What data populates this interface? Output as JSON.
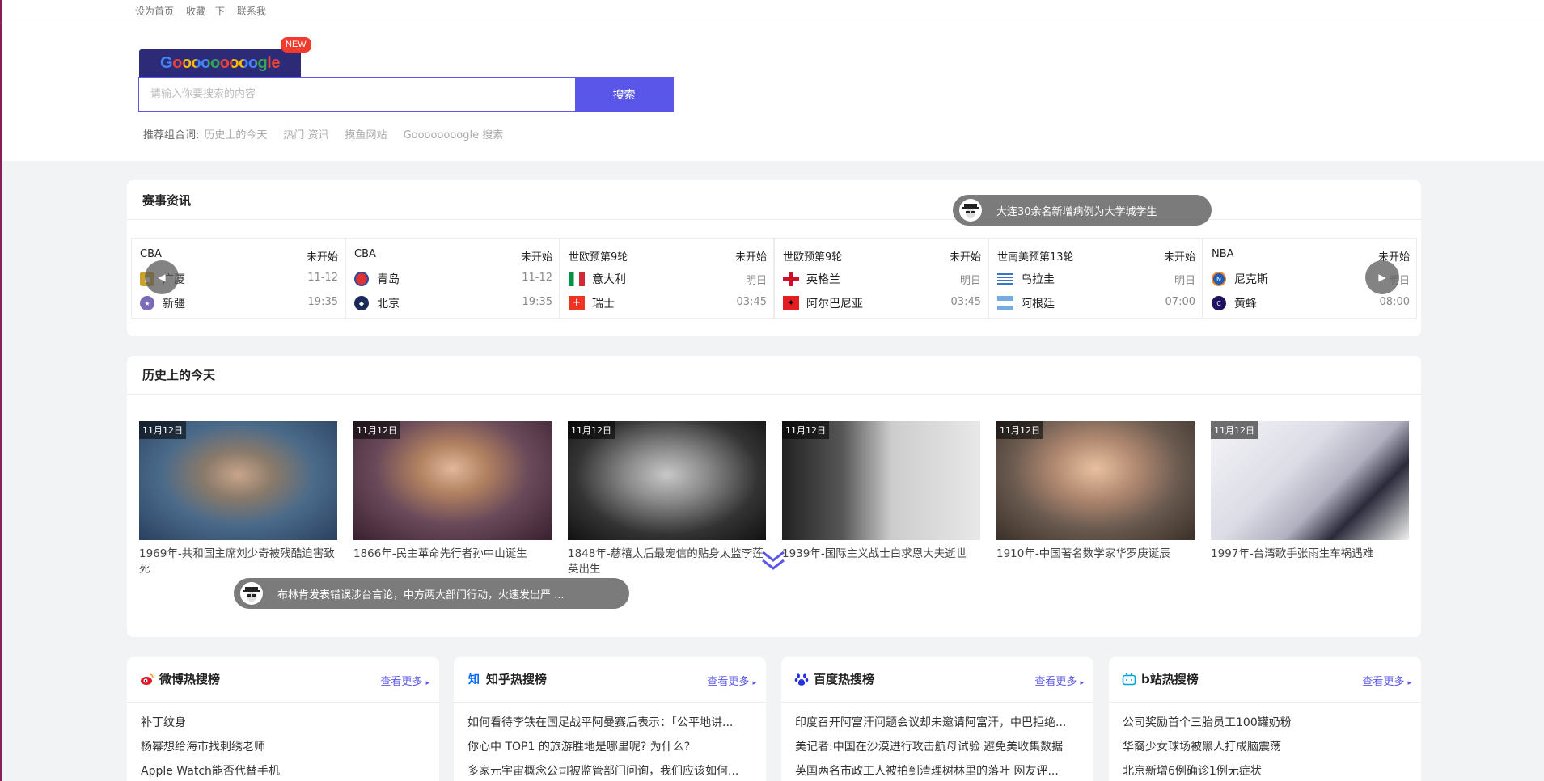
{
  "topbar": {
    "links": [
      "设为首页",
      "收藏一下",
      "联系我"
    ]
  },
  "search": {
    "logo_text": "Gooooooooogle",
    "new_badge": "NEW",
    "placeholder": "请输入你要搜索的内容",
    "button": "搜索",
    "reco_label": "推荐组合词:",
    "reco_links": [
      "历史上的今天",
      "热门 资讯",
      "摸鱼网站",
      "Goooooooogle 搜索"
    ]
  },
  "matches": {
    "title": "赛事资讯",
    "items": [
      {
        "league": "CBA",
        "status": "未开始",
        "team1": "广厦",
        "time1": "11-12",
        "team2": "新疆",
        "time2": "19:35"
      },
      {
        "league": "CBA",
        "status": "未开始",
        "team1": "青岛",
        "time1": "11-12",
        "team2": "北京",
        "time2": "19:35"
      },
      {
        "league": "世欧预第9轮",
        "status": "未开始",
        "team1": "意大利",
        "time1": "明日",
        "team2": "瑞士",
        "time2": "03:45"
      },
      {
        "league": "世欧预第9轮",
        "status": "未开始",
        "team1": "英格兰",
        "time1": "明日",
        "team2": "阿尔巴尼亚",
        "time2": "03:45"
      },
      {
        "league": "世南美预第13轮",
        "status": "未开始",
        "team1": "乌拉圭",
        "time1": "明日",
        "team2": "阿根廷",
        "time2": "07:00"
      },
      {
        "league": "NBA",
        "status": "未开始",
        "team1": "尼克斯",
        "time1": "明日",
        "team2": "黄蜂",
        "time2": "08:00"
      }
    ]
  },
  "toasts": {
    "top": "大连30余名新增病例为大学城学生",
    "bottom": "布林肯发表错误涉台言论，中方两大部门行动，火速发出严 ..."
  },
  "history": {
    "title": "历史上的今天",
    "items": [
      {
        "date": "11月12日",
        "text": "1969年-共和国主席刘少奇被残酷迫害致死"
      },
      {
        "date": "11月12日",
        "text": "1866年-民主革命先行者孙中山诞生"
      },
      {
        "date": "11月12日",
        "text": "1848年-慈禧太后最宠信的贴身太监李莲英出生"
      },
      {
        "date": "11月12日",
        "text": "1939年-国际主义战士白求恩大夫逝世"
      },
      {
        "date": "11月12日",
        "text": "1910年-中国著名数学家华罗庚诞辰"
      },
      {
        "date": "11月12日",
        "text": "1997年-台湾歌手张雨生车祸遇难"
      }
    ]
  },
  "hot": [
    {
      "title": "微博热搜榜",
      "more": "查看更多",
      "icon": "weibo-icon",
      "items": [
        "补丁纹身",
        "杨幂想给海市找刺绣老师",
        "Apple Watch能否代替手机"
      ]
    },
    {
      "title": "知乎热搜榜",
      "more": "查看更多",
      "icon": "zhihu-icon",
      "icon_text": "知",
      "items": [
        "如何看待李铁在国足战平阿曼赛后表示：「公平地讲...",
        "你心中 TOP1 的旅游胜地是哪里呢? 为什么?",
        "多家元宇宙概念公司被监管部门问询，我们应该如何..."
      ]
    },
    {
      "title": "百度热搜榜",
      "more": "查看更多",
      "icon": "baidu-paw-icon",
      "items": [
        "印度召开阿富汗问题会议却未邀请阿富汗，中巴拒绝...",
        "美记者:中国在沙漠进行攻击航母试验 避免美收集数据",
        "英国两名市政工人被拍到清理树林里的落叶 网友评..."
      ]
    },
    {
      "title": "b站热搜榜",
      "more": "查看更多",
      "icon": "bilibili-icon",
      "items": [
        "公司奖励首个三胎员工100罐奶粉",
        "华裔少女球场被黑人打成脑震荡",
        "北京新增6例确诊1例无症状"
      ]
    }
  ]
}
